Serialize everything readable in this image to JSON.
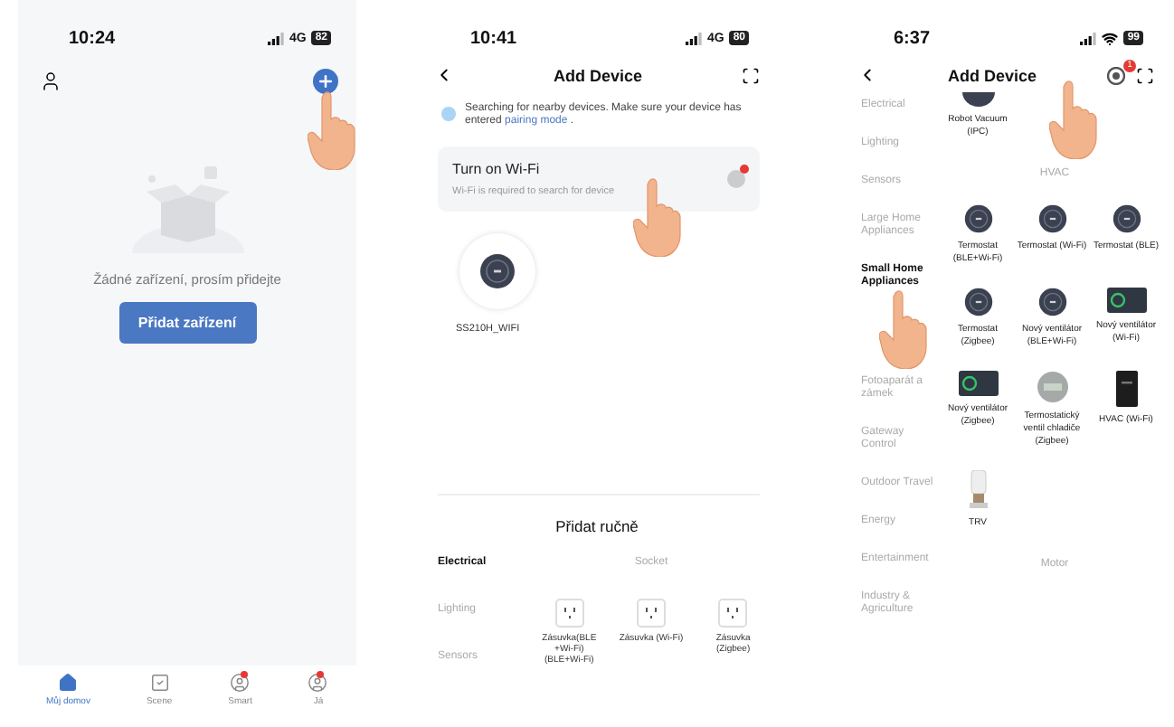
{
  "home_screen": {
    "status": {
      "time": "10:24",
      "network": "4G",
      "battery": "82"
    },
    "empty_message": "Žádné zařízení, prosím přidejte",
    "add_button": "Přidat zařízení",
    "tabs": [
      {
        "label": "Můj domov",
        "selected": true,
        "badge": false
      },
      {
        "label": "Scene",
        "selected": false,
        "badge": false
      },
      {
        "label": "Smart",
        "selected": false,
        "badge": true
      },
      {
        "label": "Já",
        "selected": false,
        "badge": true
      }
    ]
  },
  "search_screen": {
    "status": {
      "time": "10:41",
      "network": "4G",
      "battery": "80"
    },
    "title": "Add Device",
    "notice": "Searching for nearby devices. Make sure your device has entered",
    "notice_link": "pairing mode",
    "notice_end": ".",
    "wifi_card": {
      "title": "Turn on Wi-Fi",
      "subtitle": "Wi-Fi is required to search for device"
    },
    "found_device": "SS210H_WIFI",
    "manual_title": "Přidat ručně",
    "categories": [
      {
        "label": "Electrical",
        "selected": true
      },
      {
        "label": "Lighting",
        "selected": false
      },
      {
        "label": "Sensors",
        "selected": false
      }
    ],
    "section": "Socket",
    "devices": [
      {
        "name": "Zásuvka(BLE +Wi-Fi) (BLE+Wi-Fi)"
      },
      {
        "name": "Zásuvka (Wi-Fi)"
      },
      {
        "name": "Zásuvka (Zigbee)"
      }
    ]
  },
  "category_screen": {
    "status": {
      "time": "6:37",
      "battery": "99"
    },
    "title": "Add Device",
    "badge": "1",
    "categories": [
      {
        "label": "Electrical",
        "selected": false
      },
      {
        "label": "Lighting",
        "selected": false
      },
      {
        "label": "Sensors",
        "selected": false
      },
      {
        "label": "Large Home Appliances",
        "selected": false
      },
      {
        "label": "Small Home Appliances",
        "selected": true
      },
      {
        "label": "Fotoaparát a zámek",
        "selected": false
      },
      {
        "label": "Gateway Control",
        "selected": false
      },
      {
        "label": "Outdoor Travel",
        "selected": false
      },
      {
        "label": "Energy",
        "selected": false
      },
      {
        "label": "Entertainment",
        "selected": false
      },
      {
        "label": "Industry & Agriculture",
        "selected": false
      }
    ],
    "sections": [
      {
        "devices": [
          {
            "name": "Robot Vacuum (IPC)",
            "kind": "vacuum"
          }
        ]
      },
      {
        "title": "HVAC",
        "devices": [
          {
            "name": "Termostat (BLE+Wi-Fi)",
            "kind": "thermostat"
          },
          {
            "name": "Termostat (Wi-Fi)",
            "kind": "thermostat"
          },
          {
            "name": "Termostat (BLE)",
            "kind": "thermostat"
          },
          {
            "name": "Termostat (Zigbee)",
            "kind": "thermostat"
          },
          {
            "name": "Nový ventilátor (BLE+Wi-Fi)",
            "kind": "thermostat"
          },
          {
            "name": "Nový ventilátor (Wi-Fi)",
            "kind": "panel"
          },
          {
            "name": "Nový ventilátor (Zigbee)",
            "kind": "panel"
          },
          {
            "name": "Termostatický ventil chladiče (Zigbee)",
            "kind": "valve"
          },
          {
            "name": "HVAC (Wi-Fi)",
            "kind": "hvac"
          },
          {
            "name": "TRV",
            "kind": "trv"
          }
        ]
      },
      {
        "title": "Motor"
      }
    ]
  }
}
